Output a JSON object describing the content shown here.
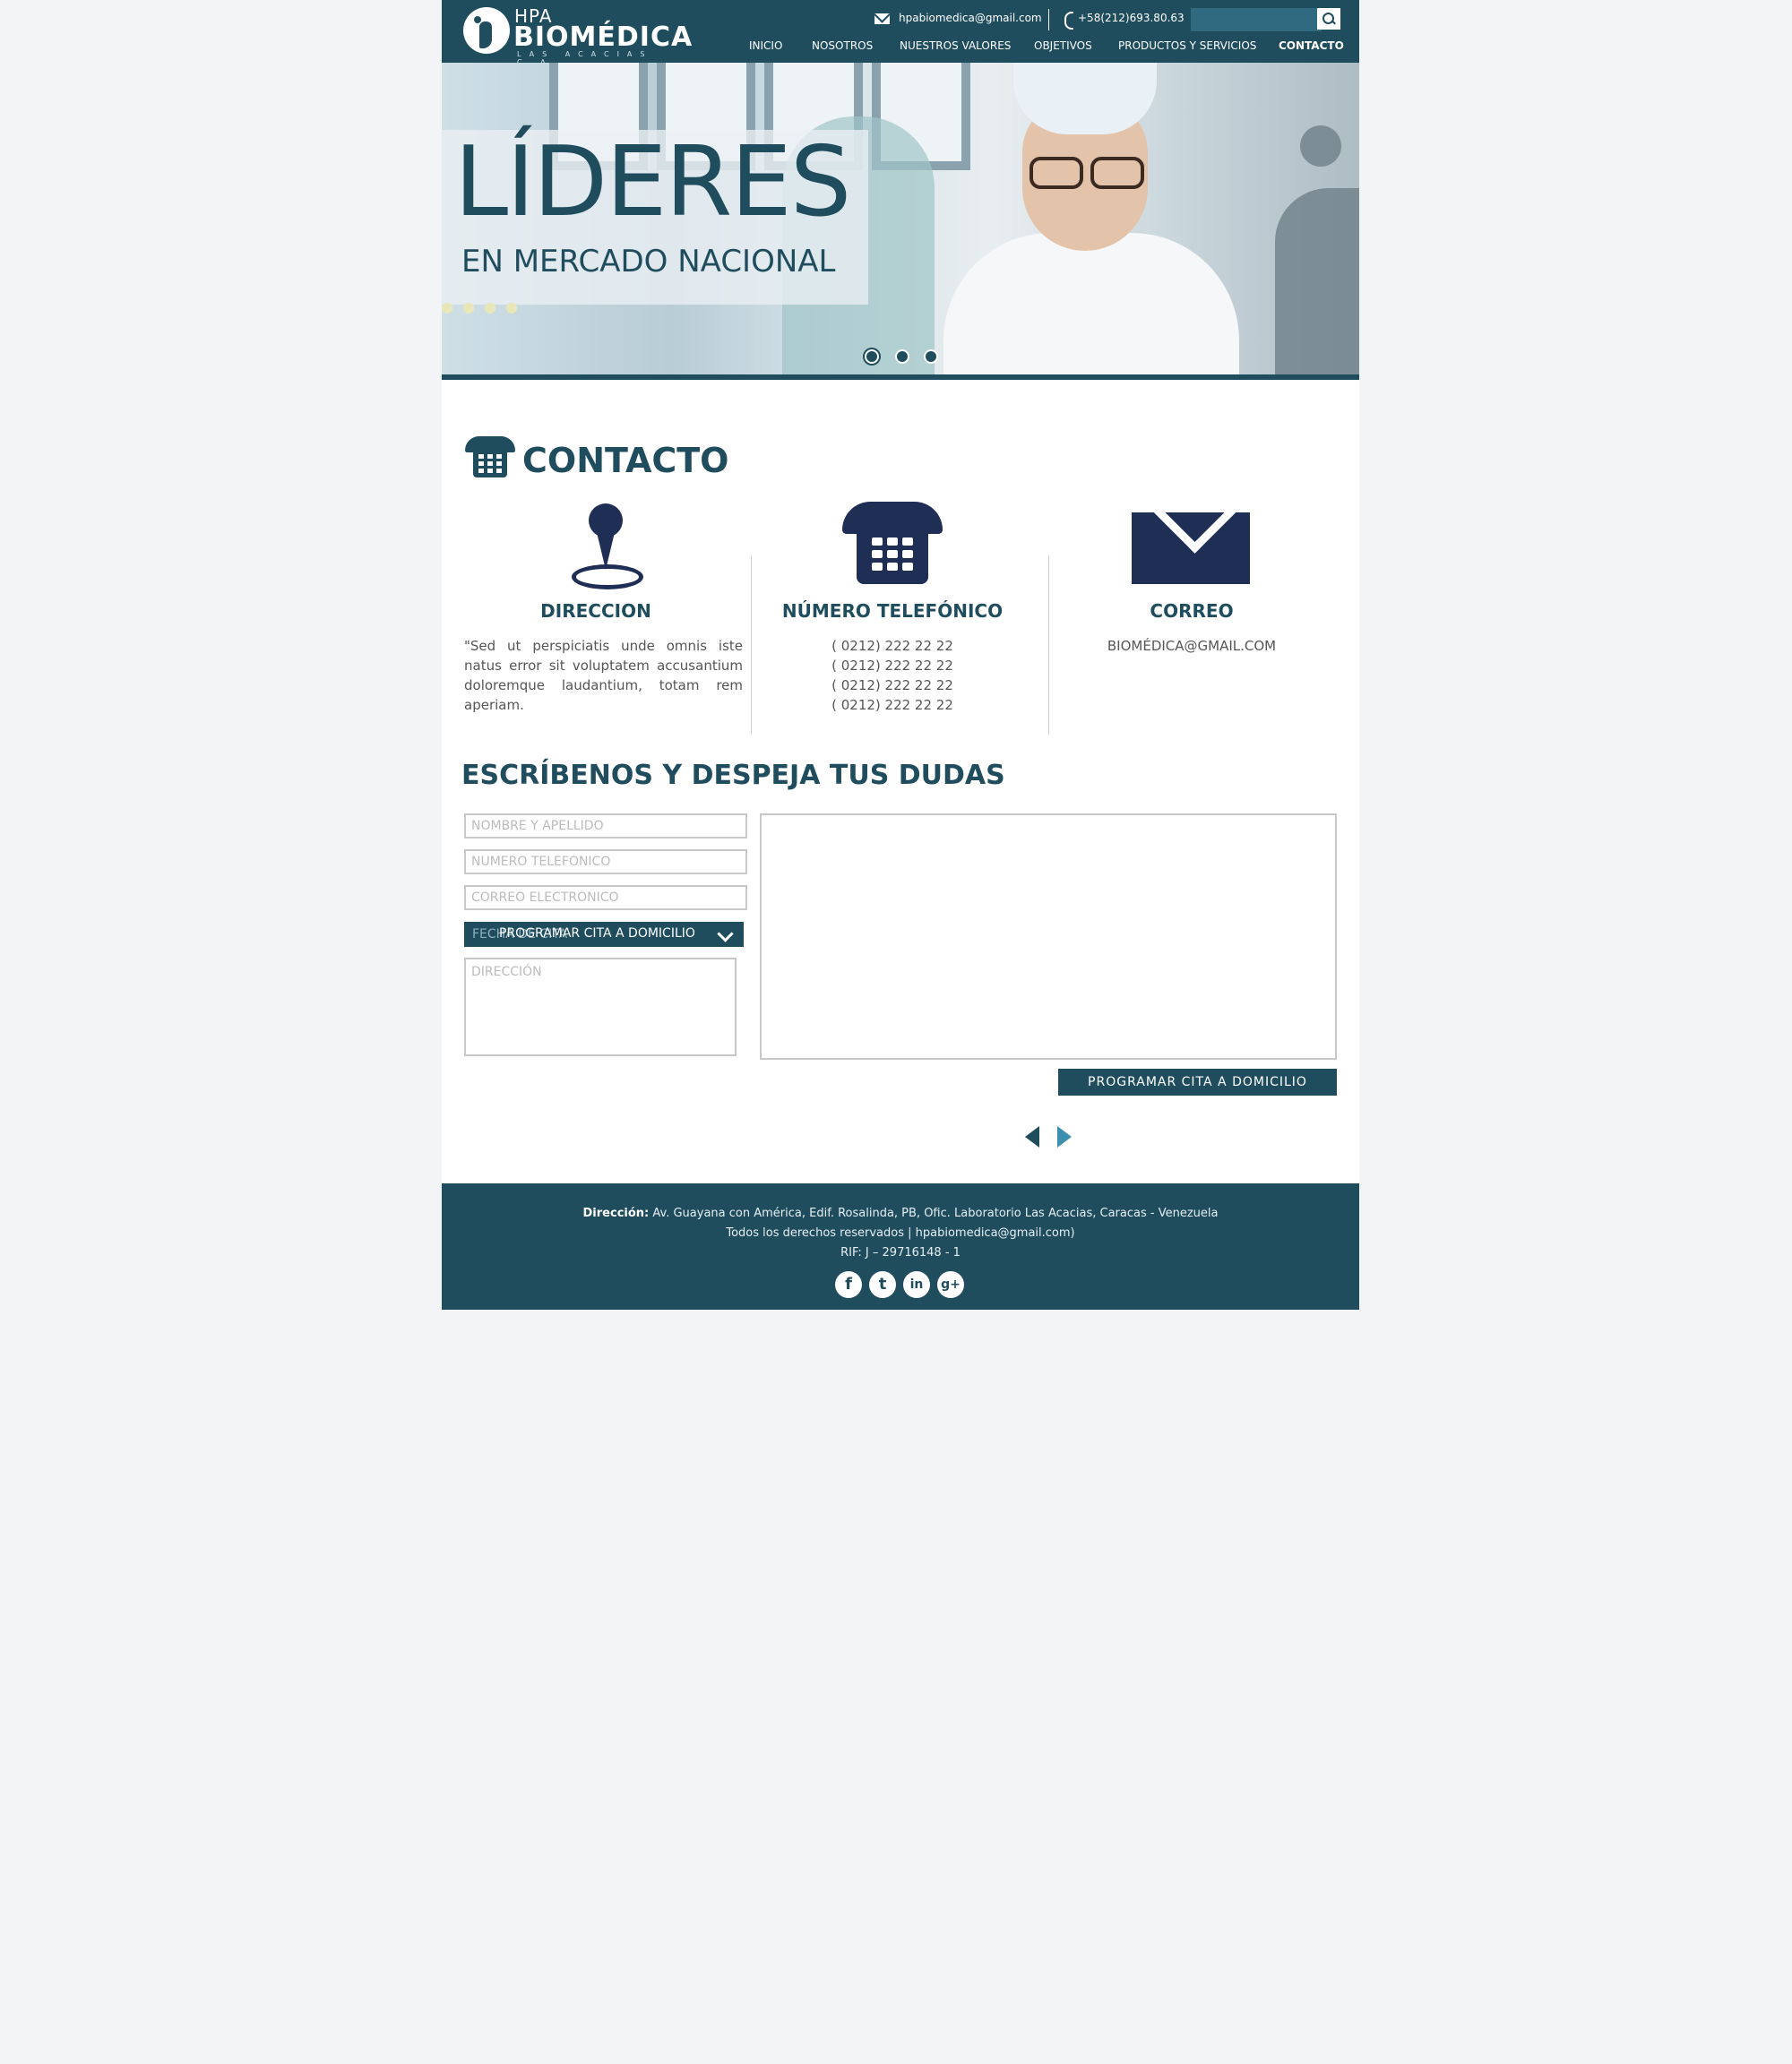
{
  "header": {
    "logo_hpa": "HPA",
    "logo_name": "BIOMÉDICA",
    "logo_sub": "LAS ACACIAS C.A",
    "email": "hpabiomedica@gmail.com",
    "phone": "+58(212)693.80.63",
    "search_placeholder": "",
    "nav": [
      "INICIO",
      "NOSOTROS",
      "NUESTROS VALORES",
      "OBJETIVOS",
      "PRODUCTOS Y SERVICIOS",
      "CONTACTO"
    ],
    "active_nav": "CONTACTO"
  },
  "hero": {
    "title": "LÍDERES",
    "subtitle": "EN MERCADO NACIONAL",
    "slide_count": 3,
    "active_slide": 1
  },
  "contact": {
    "title": "CONTACTO",
    "address": {
      "title": "DIRECCION",
      "text": "\"Sed ut perspiciatis unde omnis iste natus error sit voluptatem accusantium doloremque laudantium, totam rem aperiam."
    },
    "phones": {
      "title": "NÚMERO TELEFÓNICO",
      "numbers": [
        "( 0212) 222 22 22",
        "( 0212) 222 22 22",
        "( 0212) 222 22 22",
        "( 0212) 222 22 22"
      ]
    },
    "mail": {
      "title": "CORREO",
      "text": "BIOMÉDICA@GMAIL.COM"
    }
  },
  "form": {
    "title": "ESCRÍBENOS Y DESPEJA TUS DUDAS",
    "name_placeholder": "NOMBRE Y APELLIDO",
    "phone_placeholder": "NÚMERO TELEFÓNICO",
    "email_placeholder": "CORREO ELECTRÓNICO",
    "date_placeholder": "FECHA DE CITA",
    "select_label": "PROGRAMAR CITA A DOMICILIO",
    "address_placeholder": "DIRECCIÓN",
    "submit_label": "PROGRAMAR CITA A DOMICILIO"
  },
  "footer": {
    "address_label": "Dirección:",
    "address": "Av. Guayana con América, Edif. Rosalinda, PB, Ofic. Laboratorio Las Acacias, Caracas - Venezuela",
    "rights": "Todos los derechos reservados | hpabiomedica@gmail.com)",
    "rif": "RIF: J – 29716148 - 1",
    "social": [
      {
        "name": "facebook-icon",
        "glyph": "f"
      },
      {
        "name": "twitter-icon",
        "glyph": "t"
      },
      {
        "name": "linkedin-icon",
        "glyph": "in"
      },
      {
        "name": "google-plus-icon",
        "glyph": "g+"
      }
    ]
  },
  "colors": {
    "brand": "#1f4d5e",
    "icon_navy": "#1f2e55",
    "accent_arrow": "#3d8fb0"
  }
}
